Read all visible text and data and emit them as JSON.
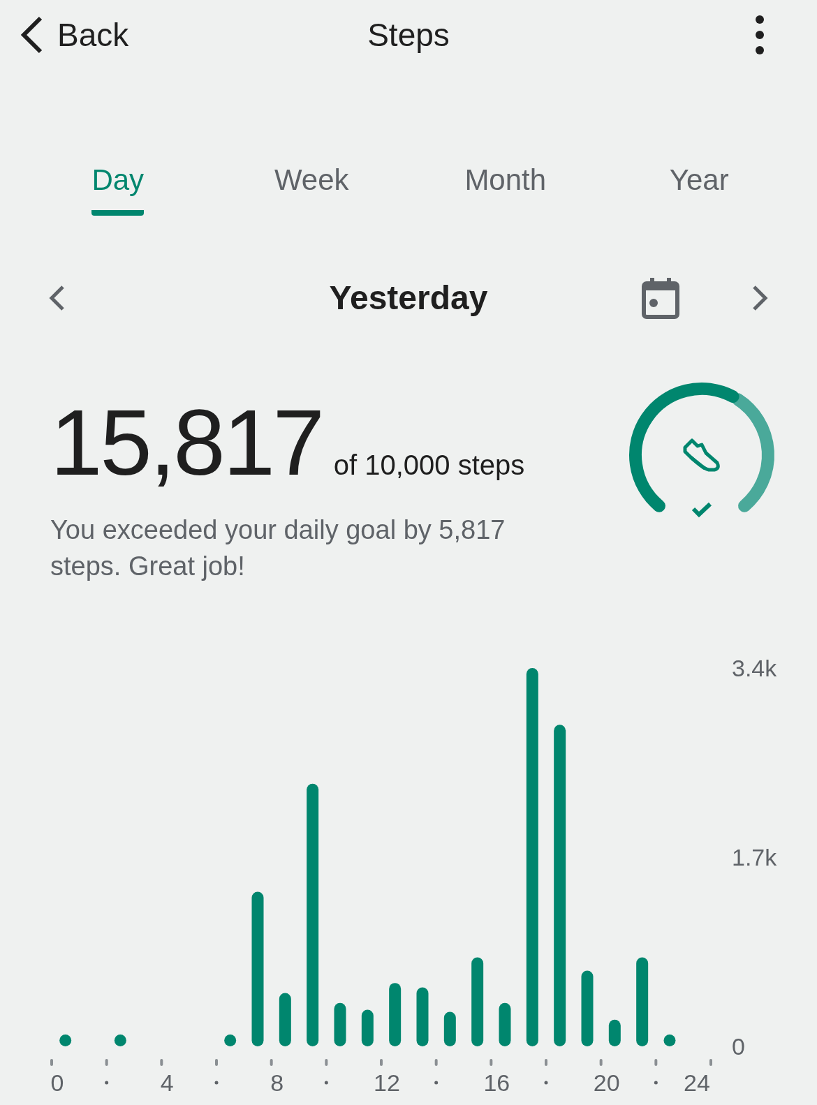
{
  "header": {
    "back_label": "Back",
    "title": "Steps"
  },
  "tabs": [
    {
      "label": "Day",
      "selected": true
    },
    {
      "label": "Week",
      "selected": false
    },
    {
      "label": "Month",
      "selected": false
    },
    {
      "label": "Year",
      "selected": false
    }
  ],
  "date_nav": {
    "label": "Yesterday"
  },
  "summary": {
    "steps": "15,817",
    "goal": "of 10,000 steps",
    "message": "You exceeded your daily goal by 5,817 steps. Great job!",
    "goal_reached": true
  },
  "chart": {
    "chart_data": {
      "type": "bar",
      "x": [
        0.5,
        2.5,
        6.5,
        7.5,
        8.5,
        9.5,
        10.5,
        11.5,
        12.5,
        13.5,
        14.5,
        15.5,
        16.5,
        17.5,
        18.5,
        19.5,
        20.5,
        21.5,
        22.5
      ],
      "series": [
        {
          "color": "#00866e",
          "values": [
            107,
            107,
            107,
            1390,
            480,
            2360,
            390,
            330,
            570,
            530,
            310,
            800,
            390,
            3400,
            2890,
            680,
            240,
            800,
            107
          ]
        }
      ],
      "xlim": [
        0,
        24
      ],
      "ylim": [
        0,
        3400
      ],
      "xticks": [
        {
          "value": 0,
          "label": "0"
        },
        {
          "value": 4,
          "label": "4"
        },
        {
          "value": 8,
          "label": "8"
        },
        {
          "value": 12,
          "label": "12"
        },
        {
          "value": 16,
          "label": "16"
        },
        {
          "value": 20,
          "label": "20"
        },
        {
          "value": 24,
          "label": "24"
        }
      ],
      "yticks": [
        {
          "value": 0,
          "label": "0"
        },
        {
          "value": 1700,
          "label": "1.7k"
        },
        {
          "value": 3400,
          "label": "3.4k"
        }
      ]
    }
  }
}
